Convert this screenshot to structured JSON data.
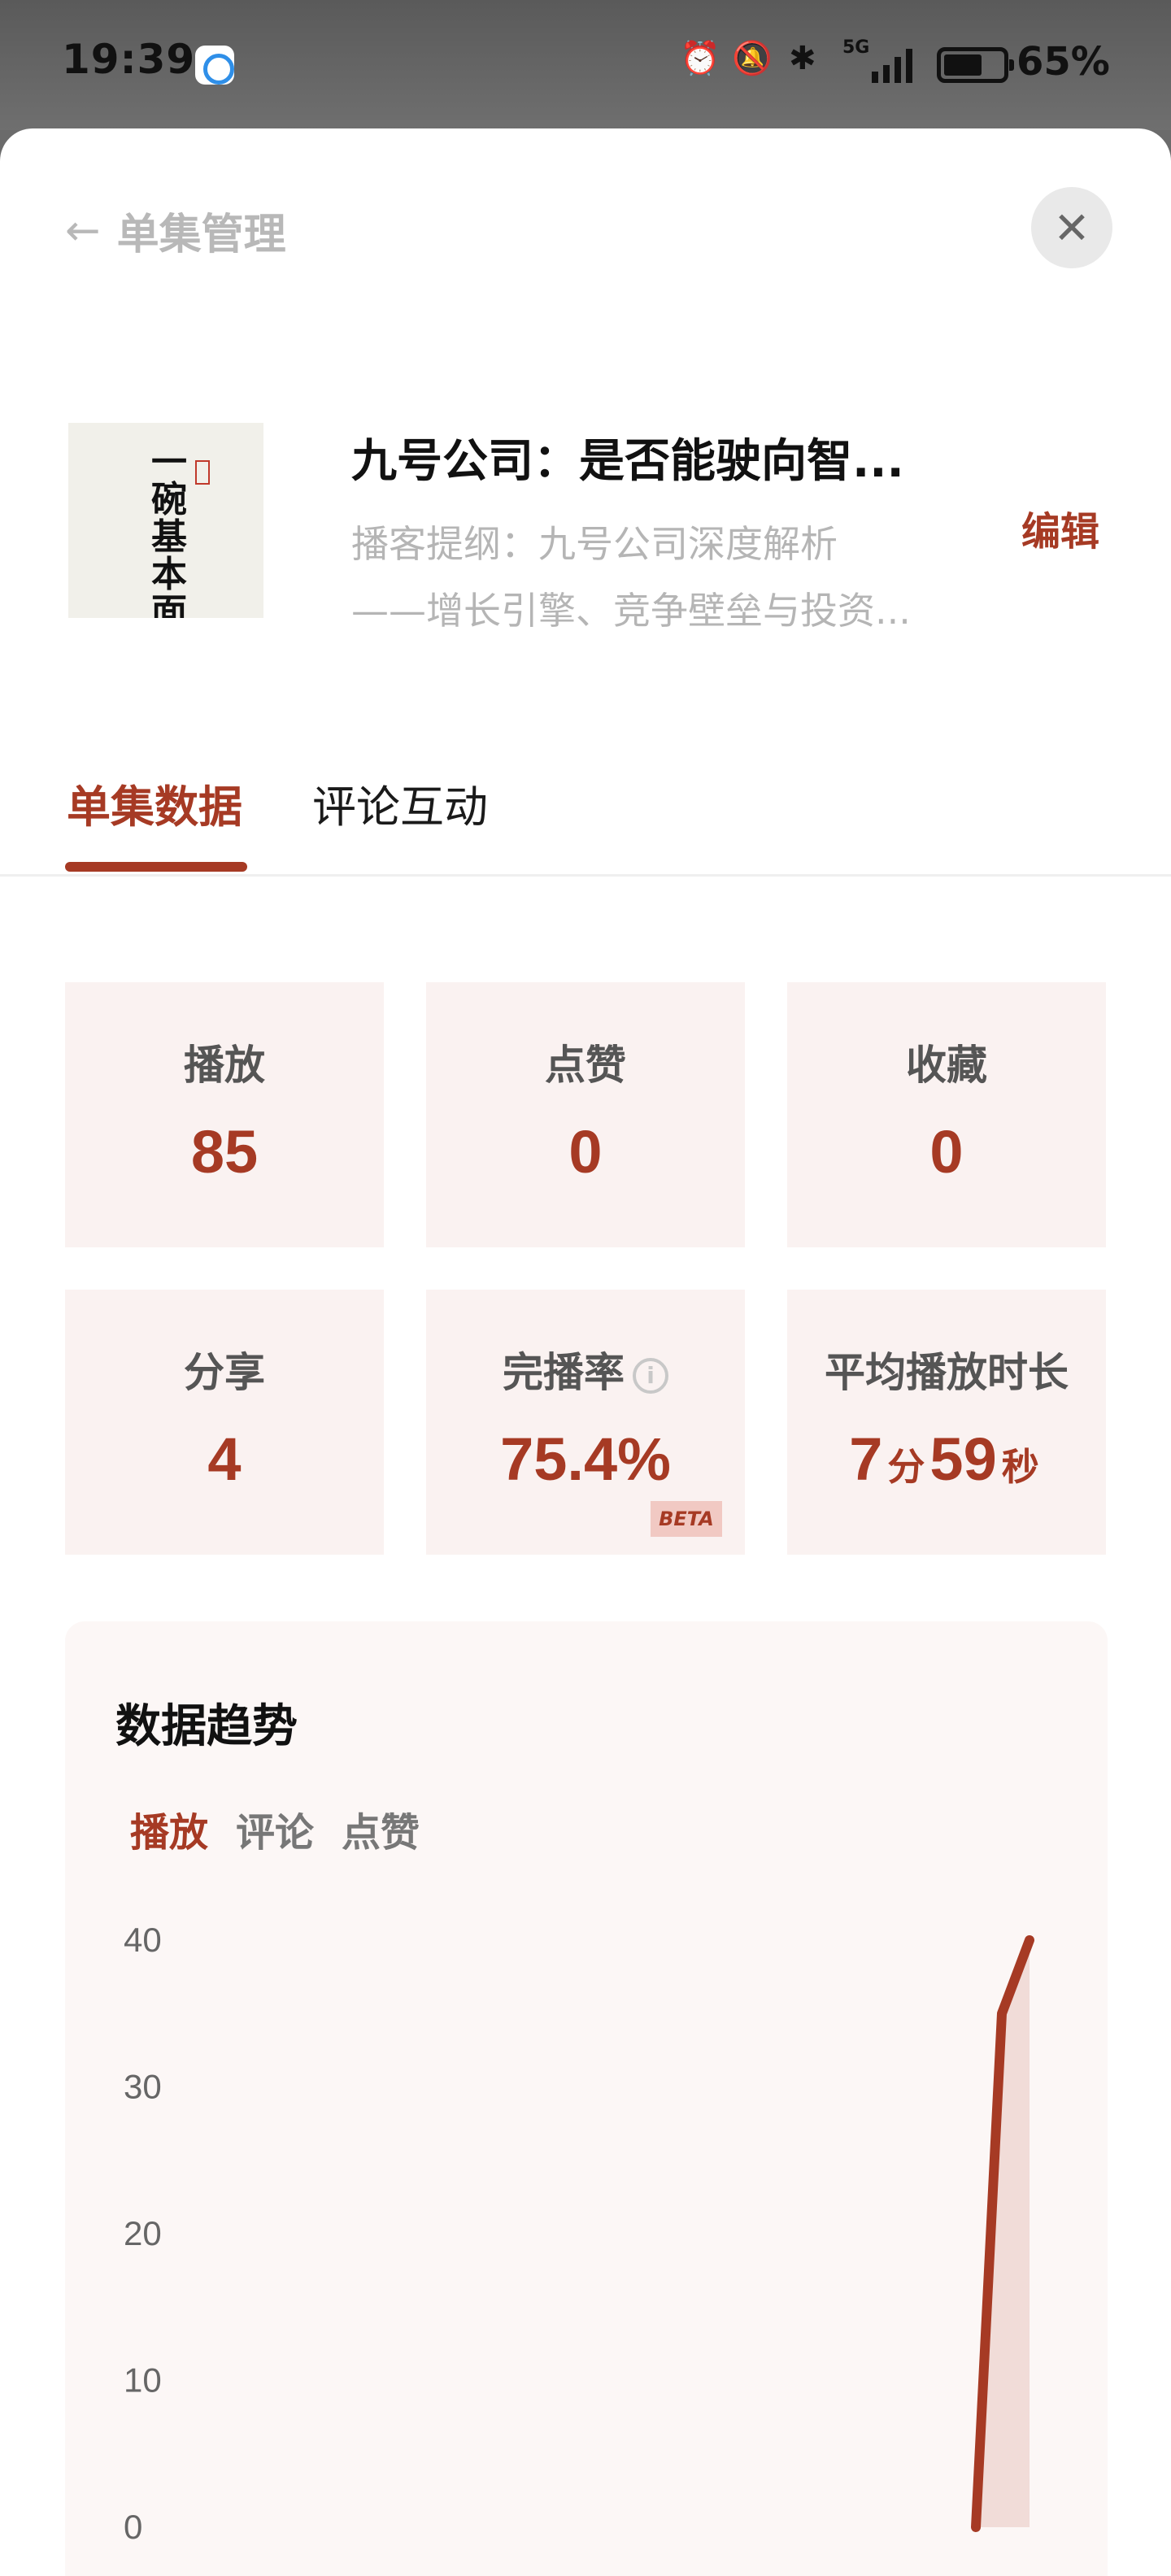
{
  "status_bar": {
    "time": "19:39",
    "app_icon": "app-notification-icon",
    "icons": [
      "alarm-icon",
      "bell-off-icon",
      "bluetooth-icon",
      "signal-5g-icon"
    ],
    "network": "5G",
    "battery_level": 0.65,
    "battery_text": "65%"
  },
  "header": {
    "back_icon": "arrow-left-icon",
    "title": "单集管理",
    "close_icon": "close-icon"
  },
  "episode": {
    "cover_text": "一碗基本面",
    "title": "九号公司：是否能驶向智...",
    "description_line1": "播客提纲：九号公司深度解析",
    "description_line2": "——增长引擎、竞争壁垒与投资...",
    "edit_label": "编辑"
  },
  "tabs": [
    {
      "label": "单集数据",
      "active": true
    },
    {
      "label": "评论互动",
      "active": false
    }
  ],
  "stats": [
    {
      "label": "播放",
      "value": "85"
    },
    {
      "label": "点赞",
      "value": "0"
    },
    {
      "label": "收藏",
      "value": "0"
    },
    {
      "label": "分享",
      "value": "4"
    },
    {
      "label": "完播率",
      "value": "75.4%",
      "badge": "BETA"
    },
    {
      "label": "平均播放时长",
      "minutes": "7",
      "min_unit": "分",
      "seconds": "59",
      "sec_unit": "秒"
    }
  ],
  "trend": {
    "title": "数据趋势",
    "tabs": [
      {
        "label": "播放",
        "active": true
      },
      {
        "label": "评论",
        "active": false
      },
      {
        "label": "点赞",
        "active": false
      }
    ]
  },
  "colors": {
    "accent": "#a63a24",
    "stat_bg": "#faf2f1",
    "card_bg": "#fcf7f6"
  },
  "chart_data": {
    "type": "area",
    "y_ticks": [
      40,
      30,
      20,
      10,
      0
    ],
    "ylim": [
      0,
      40
    ],
    "series": [
      {
        "values": [
          0,
          35,
          40
        ]
      }
    ]
  }
}
